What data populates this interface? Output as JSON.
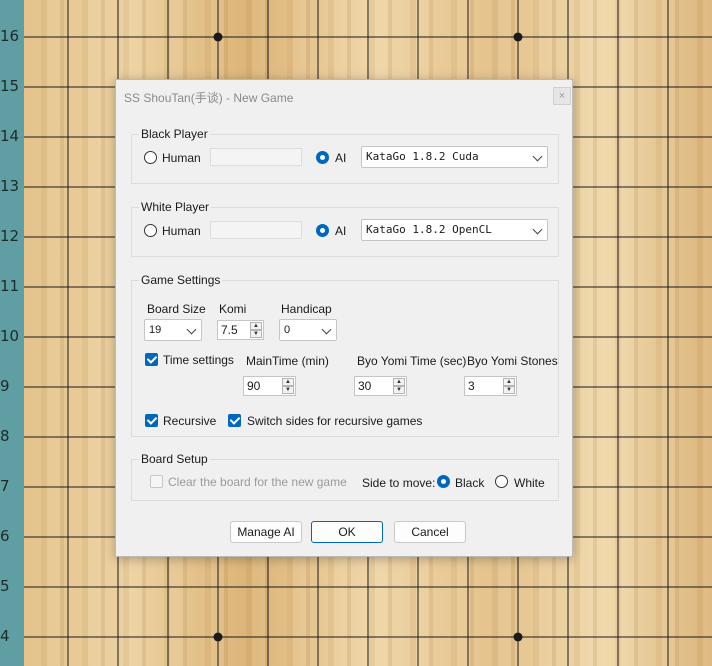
{
  "board": {
    "row_labels": [
      "16",
      "15",
      "14",
      "13",
      "12",
      "11",
      "10",
      "9",
      "8",
      "7",
      "6",
      "5",
      "4"
    ]
  },
  "dialog": {
    "title": "SS ShouTan(手谈) - New Game",
    "close_label": "×",
    "black_player": {
      "group_label": "Black Player",
      "human_label": "Human",
      "ai_label": "AI",
      "human_selected": false,
      "ai_selected": true,
      "engine": "KataGo 1.8.2 Cuda"
    },
    "white_player": {
      "group_label": "White Player",
      "human_label": "Human",
      "ai_label": "AI",
      "human_selected": false,
      "ai_selected": true,
      "engine": "KataGo 1.8.2 OpenCL"
    },
    "game_settings": {
      "group_label": "Game Settings",
      "board_size_label": "Board Size",
      "board_size": "19",
      "komi_label": "Komi",
      "komi": "7.5",
      "handicap_label": "Handicap",
      "handicap": "0",
      "time_settings_label": "Time settings",
      "time_settings_checked": true,
      "main_time_label": "MainTime (min)",
      "main_time": "90",
      "byo_yomi_time_label": "Byo Yomi Time (sec)",
      "byo_yomi_time": "30",
      "byo_yomi_stones_label": "Byo Yomi Stones",
      "byo_yomi_stones": "3",
      "recursive_label": "Recursive",
      "recursive_checked": true,
      "switch_sides_label": "Switch sides for recursive games",
      "switch_sides_checked": true
    },
    "board_setup": {
      "group_label": "Board Setup",
      "clear_board_label": "Clear the board for the new game",
      "clear_board_checked": false,
      "side_to_move_label": "Side to move:",
      "black_label": "Black",
      "white_label": "White",
      "side_to_move": "Black"
    },
    "buttons": {
      "manage_ai": "Manage AI",
      "ok": "OK",
      "cancel": "Cancel"
    }
  },
  "colors": {
    "accent": "#0067c0",
    "coordinate_strip": "#5f9ea2",
    "grid_line": "#1a1a1a"
  }
}
